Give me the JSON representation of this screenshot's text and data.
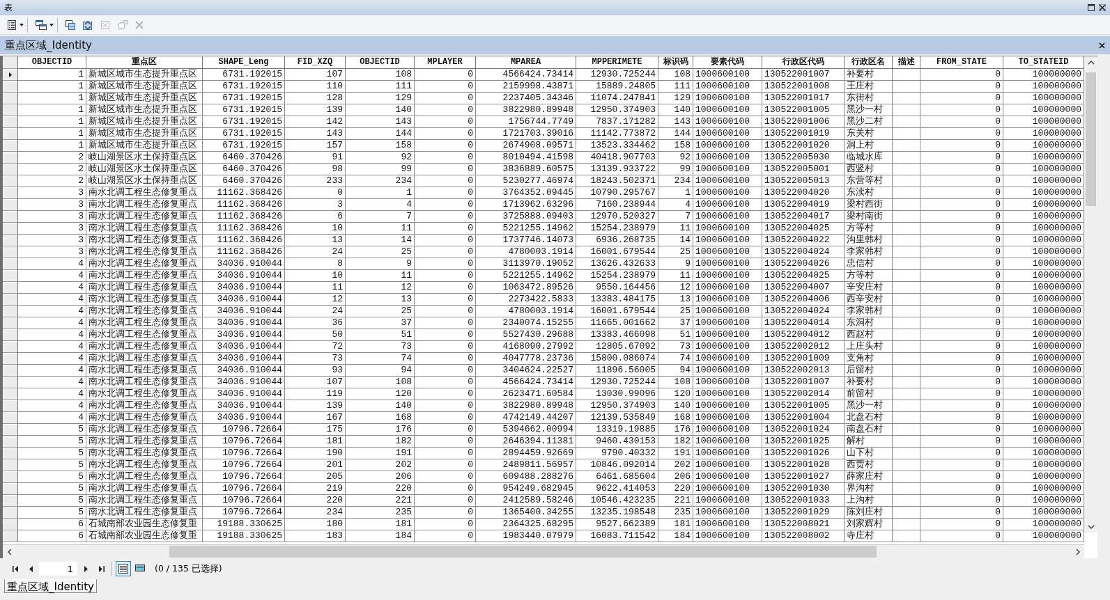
{
  "window": {
    "title": "表"
  },
  "toolbar": [
    {
      "kind": "table-options",
      "dropdown": true,
      "disabled": false,
      "separator_after": true
    },
    {
      "kind": "related-tables",
      "dropdown": true,
      "disabled": false,
      "separator_after": true
    },
    {
      "kind": "select-by-attributes",
      "dropdown": false,
      "disabled": false,
      "separator_after": false
    },
    {
      "kind": "switch-selection",
      "dropdown": false,
      "disabled": false,
      "separator_after": false
    },
    {
      "kind": "clear-selection",
      "dropdown": false,
      "disabled": true,
      "separator_after": false
    },
    {
      "kind": "zoom-to-selected",
      "dropdown": false,
      "disabled": true,
      "separator_after": false
    },
    {
      "kind": "delete",
      "dropdown": false,
      "disabled": true,
      "separator_after": false
    }
  ],
  "table": {
    "title": "重点区域_Identity",
    "columns": [
      {
        "name": "OBJECTID",
        "kind": "number"
      },
      {
        "name": "重点区",
        "kind": "text"
      },
      {
        "name": "SHAPE_Leng",
        "kind": "number"
      },
      {
        "name": "FID_XZQ",
        "kind": "number"
      },
      {
        "name": "OBJECTID",
        "kind": "number"
      },
      {
        "name": "MPLAYER",
        "kind": "number"
      },
      {
        "name": "MPAREA",
        "kind": "number"
      },
      {
        "name": "MPPERIMETE",
        "kind": "number"
      },
      {
        "name": "标识码",
        "kind": "number"
      },
      {
        "name": "要素代码",
        "kind": "text"
      },
      {
        "name": "行政区代码",
        "kind": "text"
      },
      {
        "name": "行政区名",
        "kind": "text"
      },
      {
        "name": "描述",
        "kind": "text"
      },
      {
        "name": "FROM_STATE",
        "kind": "number"
      },
      {
        "name": "TO_STATEID",
        "kind": "number"
      }
    ],
    "rows": [
      {
        "current": true,
        "cells": [
          "1",
          "新城区城市生态提升重点区",
          "6731.192015",
          "107",
          "108",
          "0",
          "4566424.73414",
          "12930.725244",
          "108",
          "1000600100",
          "130522001007",
          "补要村",
          null,
          "0",
          "100000000"
        ]
      },
      {
        "current": false,
        "cells": [
          "1",
          "新城区城市生态提升重点区",
          "6731.192015",
          "110",
          "111",
          "0",
          "2159998.43871",
          "15889.24805",
          "111",
          "1000600100",
          "130522001008",
          "王庄村",
          null,
          "0",
          "100000000"
        ]
      },
      {
        "current": false,
        "cells": [
          "1",
          "新城区城市生态提升重点区",
          "6731.192015",
          "128",
          "129",
          "0",
          "2237405.34346",
          "11074.247841",
          "129",
          "1000600100",
          "130522001017",
          "东街村",
          null,
          "0",
          "100000000"
        ]
      },
      {
        "current": false,
        "cells": [
          "1",
          "新城区城市生态提升重点区",
          "6731.192015",
          "139",
          "140",
          "0",
          "3822980.89948",
          "12950.374903",
          "140",
          "1000600100",
          "130522001005",
          "黑沙一村",
          null,
          "0",
          "100000000"
        ]
      },
      {
        "current": false,
        "cells": [
          "1",
          "新城区城市生态提升重点区",
          "6731.192015",
          "142",
          "143",
          "0",
          "1756744.7749",
          "7837.171282",
          "143",
          "1000600100",
          "130522001006",
          "黑沙二村",
          null,
          "0",
          "100000000"
        ]
      },
      {
        "current": false,
        "cells": [
          "1",
          "新城区城市生态提升重点区",
          "6731.192015",
          "143",
          "144",
          "0",
          "1721703.39016",
          "11142.773872",
          "144",
          "1000600100",
          "130522001019",
          "东关村",
          null,
          "0",
          "100000000"
        ]
      },
      {
        "current": false,
        "cells": [
          "1",
          "新城区城市生态提升重点区",
          "6731.192015",
          "157",
          "158",
          "0",
          "2674908.09571",
          "13523.334462",
          "158",
          "1000600100",
          "130522001020",
          "洞上村",
          null,
          "0",
          "100000000"
        ]
      },
      {
        "current": false,
        "cells": [
          "2",
          "岐山湖景区水土保持重点区",
          "6460.370426",
          "91",
          "92",
          "0",
          "8010494.41598",
          "40418.907703",
          "92",
          "1000600100",
          "130522005030",
          "临城水库",
          null,
          "0",
          "100000000"
        ]
      },
      {
        "current": false,
        "cells": [
          "2",
          "岐山湖景区水土保持重点区",
          "6460.370426",
          "98",
          "99",
          "0",
          "3836889.60575",
          "13139.933722",
          "99",
          "1000600100",
          "130522005001",
          "西竖村",
          null,
          "0",
          "100000000"
        ]
      },
      {
        "current": false,
        "cells": [
          "2",
          "岐山湖景区水土保持重点区",
          "6460.370426",
          "233",
          "234",
          "0",
          "5230277.46974",
          "18243.502371",
          "234",
          "1000600100",
          "130522005013",
          "东营等村",
          null,
          "0",
          "100000000"
        ]
      },
      {
        "current": false,
        "cells": [
          "3",
          "南水北调工程生态修复重点",
          "11162.368426",
          "0",
          "1",
          "0",
          "3764352.09445",
          "10790.295767",
          "1",
          "1000600100",
          "130522004020",
          "东渎村",
          null,
          "0",
          "100000000"
        ]
      },
      {
        "current": false,
        "cells": [
          "3",
          "南水北调工程生态修复重点",
          "11162.368426",
          "3",
          "4",
          "0",
          "1713962.63296",
          "7160.238944",
          "4",
          "1000600100",
          "130522004019",
          "梁村西街",
          null,
          "0",
          "100000000"
        ]
      },
      {
        "current": false,
        "cells": [
          "3",
          "南水北调工程生态修复重点",
          "11162.368426",
          "6",
          "7",
          "0",
          "3725888.09403",
          "12970.520327",
          "7",
          "1000600100",
          "130522004017",
          "梁村南街",
          null,
          "0",
          "100000000"
        ]
      },
      {
        "current": false,
        "cells": [
          "3",
          "南水北调工程生态修复重点",
          "11162.368426",
          "10",
          "11",
          "0",
          "5221255.14962",
          "15254.238979",
          "11",
          "1000600100",
          "130522004025",
          "方等村",
          null,
          "0",
          "100000000"
        ]
      },
      {
        "current": false,
        "cells": [
          "3",
          "南水北调工程生态修复重点",
          "11162.368426",
          "13",
          "14",
          "0",
          "1737746.14073",
          "6936.268735",
          "14",
          "1000600100",
          "130522004022",
          "沟里韩村",
          null,
          "0",
          "100000000"
        ]
      },
      {
        "current": false,
        "cells": [
          "3",
          "南水北调工程生态修复重点",
          "11162.368426",
          "24",
          "25",
          "0",
          "4780003.1914",
          "16001.679544",
          "25",
          "1000600100",
          "130522004024",
          "李家韩村",
          null,
          "0",
          "100000000"
        ]
      },
      {
        "current": false,
        "cells": [
          "4",
          "南水北调工程生态修复重点",
          "34036.910044",
          "8",
          "9",
          "0",
          "3113970.19052",
          "13626.432633",
          "9",
          "1000600100",
          "130522004026",
          "忠信村",
          null,
          "0",
          "100000000"
        ]
      },
      {
        "current": false,
        "cells": [
          "4",
          "南水北调工程生态修复重点",
          "34036.910044",
          "10",
          "11",
          "0",
          "5221255.14962",
          "15254.238979",
          "11",
          "1000600100",
          "130522004025",
          "方等村",
          null,
          "0",
          "100000000"
        ]
      },
      {
        "current": false,
        "cells": [
          "4",
          "南水北调工程生态修复重点",
          "34036.910044",
          "11",
          "12",
          "0",
          "1063472.89526",
          "9550.164456",
          "12",
          "1000600100",
          "130522004007",
          "辛安庄村",
          null,
          "0",
          "100000000"
        ]
      },
      {
        "current": false,
        "cells": [
          "4",
          "南水北调工程生态修复重点",
          "34036.910044",
          "12",
          "13",
          "0",
          "2273422.5833",
          "13383.484175",
          "13",
          "1000600100",
          "130522004006",
          "西辛安村",
          null,
          "0",
          "100000000"
        ]
      },
      {
        "current": false,
        "cells": [
          "4",
          "南水北调工程生态修复重点",
          "34036.910044",
          "24",
          "25",
          "0",
          "4780003.1914",
          "16001.679544",
          "25",
          "1000600100",
          "130522004024",
          "李家韩村",
          null,
          "0",
          "100000000"
        ]
      },
      {
        "current": false,
        "cells": [
          "4",
          "南水北调工程生态修复重点",
          "34036.910044",
          "36",
          "37",
          "0",
          "2340074.15255",
          "11665.001662",
          "37",
          "1000600100",
          "130522004014",
          "东洞村",
          null,
          "0",
          "100000000"
        ]
      },
      {
        "current": false,
        "cells": [
          "4",
          "南水北调工程生态修复重点",
          "34036.910044",
          "50",
          "51",
          "0",
          "5527430.29688",
          "13383.466098",
          "51",
          "1000600100",
          "130522004012",
          "西赵村",
          null,
          "0",
          "100000000"
        ]
      },
      {
        "current": false,
        "cells": [
          "4",
          "南水北调工程生态修复重点",
          "34036.910044",
          "72",
          "73",
          "0",
          "4168090.27992",
          "12805.67092",
          "73",
          "1000600100",
          "130522002012",
          "上庄头村",
          null,
          "0",
          "100000000"
        ]
      },
      {
        "current": false,
        "cells": [
          "4",
          "南水北调工程生态修复重点",
          "34036.910044",
          "73",
          "74",
          "0",
          "4047778.23736",
          "15800.086074",
          "74",
          "1000600100",
          "130522001009",
          "支角村",
          null,
          "0",
          "100000000"
        ]
      },
      {
        "current": false,
        "cells": [
          "4",
          "南水北调工程生态修复重点",
          "34036.910044",
          "93",
          "94",
          "0",
          "3404624.22527",
          "11896.56005",
          "94",
          "1000600100",
          "130522002013",
          "后留村",
          null,
          "0",
          "100000000"
        ]
      },
      {
        "current": false,
        "cells": [
          "4",
          "南水北调工程生态修复重点",
          "34036.910044",
          "107",
          "108",
          "0",
          "4566424.73414",
          "12930.725244",
          "108",
          "1000600100",
          "130522001007",
          "补要村",
          null,
          "0",
          "100000000"
        ]
      },
      {
        "current": false,
        "cells": [
          "4",
          "南水北调工程生态修复重点",
          "34036.910044",
          "119",
          "120",
          "0",
          "2623471.60584",
          "13030.99096",
          "120",
          "1000600100",
          "130522002014",
          "前留村",
          null,
          "0",
          "100000000"
        ]
      },
      {
        "current": false,
        "cells": [
          "4",
          "南水北调工程生态修复重点",
          "34036.910044",
          "139",
          "140",
          "0",
          "3822980.89948",
          "12950.374903",
          "140",
          "1000600100",
          "130522001005",
          "黑沙一村",
          null,
          "0",
          "100000000"
        ]
      },
      {
        "current": false,
        "cells": [
          "4",
          "南水北调工程生态修复重点",
          "34036.910044",
          "167",
          "168",
          "0",
          "4742149.44207",
          "12139.535849",
          "168",
          "1000600100",
          "130522001004",
          "北盘石村",
          null,
          "0",
          "100000000"
        ]
      },
      {
        "current": false,
        "cells": [
          "5",
          "南水北调工程生态修复重点",
          "10796.72664",
          "175",
          "176",
          "0",
          "5394662.00994",
          "13319.19885",
          "176",
          "1000600100",
          "130522001024",
          "南盘石村",
          null,
          "0",
          "100000000"
        ]
      },
      {
        "current": false,
        "cells": [
          "5",
          "南水北调工程生态修复重点",
          "10796.72664",
          "181",
          "182",
          "0",
          "2646394.11381",
          "9460.430153",
          "182",
          "1000600100",
          "130522001025",
          "解村",
          null,
          "0",
          "100000000"
        ]
      },
      {
        "current": false,
        "cells": [
          "5",
          "南水北调工程生态修复重点",
          "10796.72664",
          "190",
          "191",
          "0",
          "2894459.92669",
          "9790.40332",
          "191",
          "1000600100",
          "130522001026",
          "山下村",
          null,
          "0",
          "100000000"
        ]
      },
      {
        "current": false,
        "cells": [
          "5",
          "南水北调工程生态修复重点",
          "10796.72664",
          "201",
          "202",
          "0",
          "2489811.56957",
          "10846.092014",
          "202",
          "1000600100",
          "130522001028",
          "西贾村",
          null,
          "0",
          "100000000"
        ]
      },
      {
        "current": false,
        "cells": [
          "5",
          "南水北调工程生态修复重点",
          "10796.72664",
          "205",
          "206",
          "0",
          "609488.288276",
          "6461.685604",
          "206",
          "1000600100",
          "130522001027",
          "薛家庄村",
          null,
          "0",
          "100000000"
        ]
      },
      {
        "current": false,
        "cells": [
          "5",
          "南水北调工程生态修复重点",
          "10796.72664",
          "219",
          "220",
          "0",
          "954249.682945",
          "9622.414053",
          "220",
          "1000600100",
          "130522001030",
          "界沟村",
          null,
          "0",
          "100000000"
        ]
      },
      {
        "current": false,
        "cells": [
          "5",
          "南水北调工程生态修复重点",
          "10796.72664",
          "220",
          "221",
          "0",
          "2412589.58246",
          "10546.423235",
          "221",
          "1000600100",
          "130522001033",
          "上沟村",
          null,
          "0",
          "100000000"
        ]
      },
      {
        "current": false,
        "cells": [
          "5",
          "南水北调工程生态修复重点",
          "10796.72664",
          "234",
          "235",
          "0",
          "1365400.34255",
          "13235.198548",
          "235",
          "1000600100",
          "130522001029",
          "陈刘庄村",
          null,
          "0",
          "100000000"
        ]
      },
      {
        "current": false,
        "cells": [
          "6",
          "石城南部农业园生态修复重",
          "19188.330625",
          "180",
          "181",
          "0",
          "2364325.68295",
          "9527.662389",
          "181",
          "1000600100",
          "130522008021",
          "刘家辉村",
          null,
          "0",
          "100000000"
        ]
      },
      {
        "current": false,
        "cells": [
          "6",
          "石城南部农业园生态修复重",
          "19188.330625",
          "183",
          "184",
          "0",
          "1983440.07979",
          "16083.711542",
          "184",
          "1000600100",
          "130522008002",
          "寺庄村",
          null,
          "0",
          "100000000"
        ]
      }
    ]
  },
  "navigator": {
    "page": "1",
    "views": [
      {
        "kind": "all-records",
        "selected": true
      },
      {
        "kind": "selected-records",
        "selected": false
      }
    ],
    "status": "(0 / 135 已选择)"
  },
  "tabs": [
    {
      "label": "重点区域_Identity",
      "selected": true
    }
  ]
}
